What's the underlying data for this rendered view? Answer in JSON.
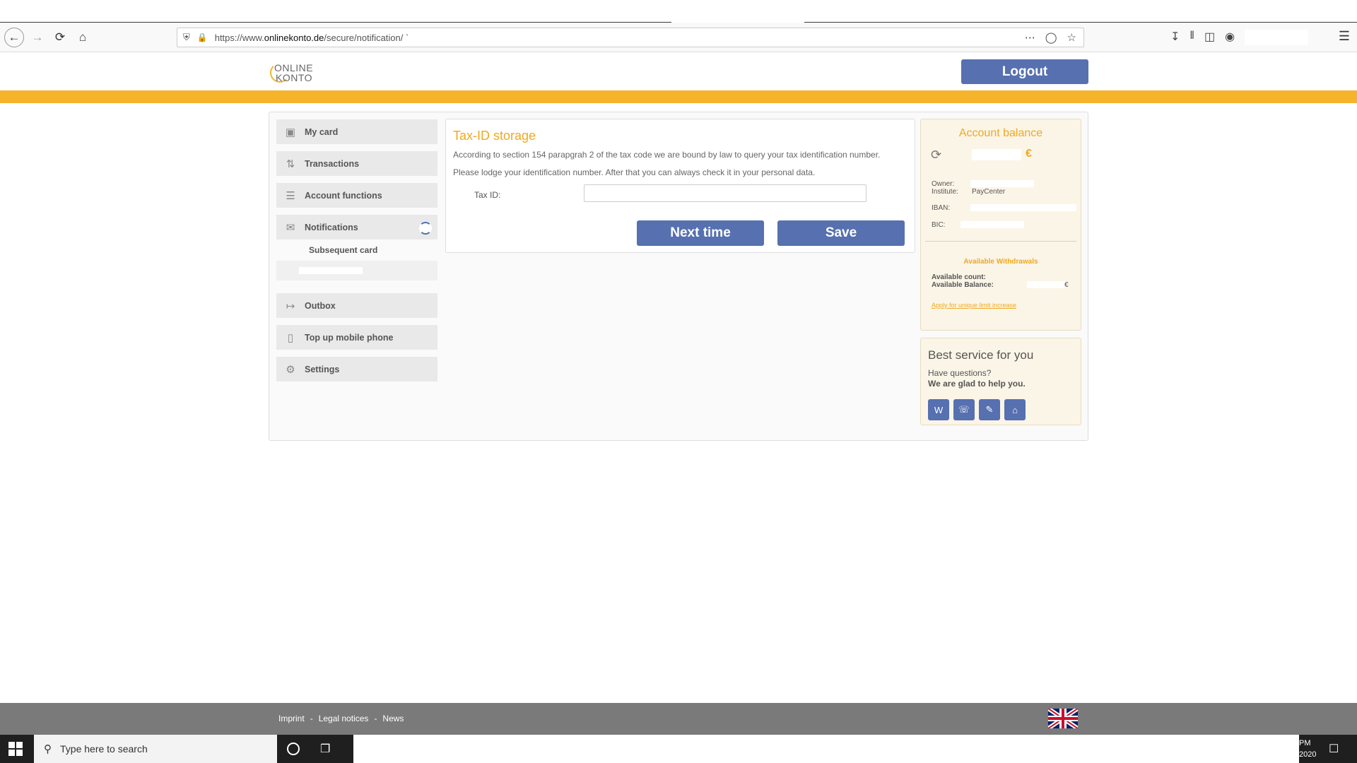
{
  "browser": {
    "url_prefix": "https://www.",
    "url_domain": "onlinekonto.de",
    "url_path": "/secure/notification/  `"
  },
  "header": {
    "logo_line1": "ONLINE",
    "logo_line2": "KONTO",
    "logout_label": "Logout"
  },
  "sidebar": {
    "items": [
      {
        "label": "My card",
        "icon": "card-icon"
      },
      {
        "label": "Transactions",
        "icon": "transactions-icon"
      },
      {
        "label": "Account functions",
        "icon": "list-icon"
      },
      {
        "label": "Notifications",
        "icon": "envelope-icon"
      },
      {
        "label": "Outbox",
        "icon": "outbox-icon"
      },
      {
        "label": "Top up mobile phone",
        "icon": "phone-icon"
      },
      {
        "label": "Settings",
        "icon": "gear-icon"
      }
    ],
    "subitems": [
      {
        "label": "Subsequent card"
      }
    ]
  },
  "taxid": {
    "title": "Tax-ID storage",
    "paragraph1": "According to section 154 parapgrah 2 of the tax code we are bound by law to query your tax identification number.",
    "paragraph2": "Please lodge your identification number. After that you can always check it in your personal data.",
    "field_label": "Tax ID:",
    "field_value": "",
    "next_label": "Next time",
    "save_label": "Save"
  },
  "account": {
    "title": "Account balance",
    "currency": "€",
    "owner_label": "Owner:",
    "institute_label": "Institute:",
    "institute_value": "PayCenter",
    "iban_label": "IBAN:",
    "bic_label": "BIC:",
    "withdrawals_title": "Available Withdrawals",
    "count_label": "Available count:",
    "balance_label": "Available Balance:",
    "limit_link": "Apply for unique limit increase"
  },
  "service": {
    "title": "Best service for you",
    "question": "Have questions?",
    "glad": "We are glad to help you.",
    "icons": [
      "wiki-icon",
      "phone-support-icon",
      "form-icon",
      "home-icon"
    ]
  },
  "footer": {
    "links": [
      "Imprint",
      "Legal notices",
      "News"
    ],
    "separator": "-"
  },
  "taskbar": {
    "search_placeholder": "Type here to search",
    "clock_line1": "PM",
    "clock_line2": "2020"
  }
}
